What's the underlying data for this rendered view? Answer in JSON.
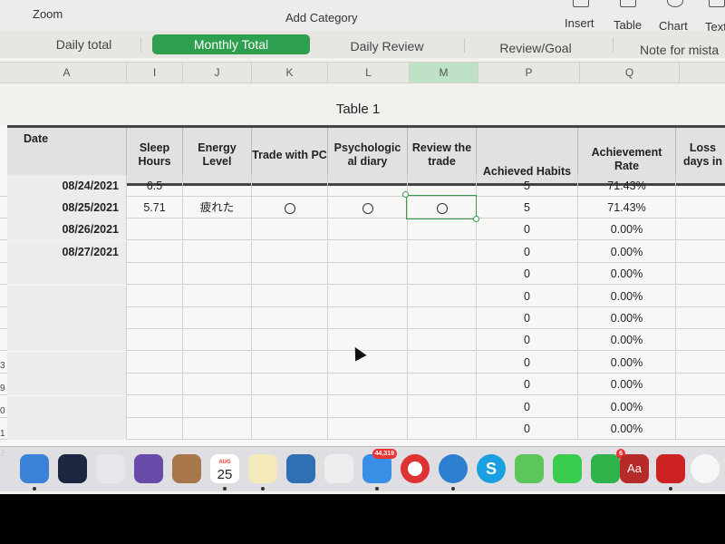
{
  "toolbar": {
    "zoom": "Zoom",
    "add_category": "Add Category",
    "insert": "Insert",
    "table": "Table",
    "chart": "Chart",
    "text": "Text"
  },
  "tabs": [
    {
      "label": "Daily total",
      "active": false
    },
    {
      "label": "Monthly Total",
      "active": true
    },
    {
      "label": "Daily Review",
      "active": false
    },
    {
      "label": "Review/Goal",
      "active": false
    },
    {
      "label": "Note for mista",
      "active": false
    }
  ],
  "columns": [
    "A",
    "I",
    "J",
    "K",
    "L",
    "M",
    "P",
    "Q"
  ],
  "selected_column": "M",
  "table_title": "Table 1",
  "headers": {
    "date": "Date",
    "sleep": "Sleep Hours",
    "energy": "Energy Level",
    "trade_pc": "Trade with PC",
    "psych": "Psychologic al diary",
    "review": "Review the trade",
    "habits": "Achieved Habits",
    "rate": "Achievement Rate",
    "loss": "Loss days in"
  },
  "partial_row": {
    "date": "08/24/2021",
    "sleep": "6.5",
    "energy": "",
    "habits": "5",
    "rate": "71.43%"
  },
  "rows": [
    {
      "date": "08/25/2021",
      "sleep": "5.71",
      "energy": "疲れた",
      "trade_pc": "○",
      "psych": "○",
      "review": "○",
      "habits": "5",
      "rate": "71.43%"
    },
    {
      "date": "08/26/2021",
      "sleep": "",
      "energy": "",
      "trade_pc": "",
      "psych": "",
      "review": "",
      "habits": "0",
      "rate": "0.00%"
    },
    {
      "date": "08/27/2021",
      "sleep": "",
      "energy": "",
      "trade_pc": "",
      "psych": "",
      "review": "",
      "habits": "0",
      "rate": "0.00%"
    },
    {
      "date": "",
      "sleep": "",
      "energy": "",
      "trade_pc": "",
      "psych": "",
      "review": "",
      "habits": "0",
      "rate": "0.00%"
    },
    {
      "date": "",
      "sleep": "",
      "energy": "",
      "trade_pc": "",
      "psych": "",
      "review": "",
      "habits": "0",
      "rate": "0.00%"
    },
    {
      "date": "",
      "sleep": "",
      "energy": "",
      "trade_pc": "",
      "psych": "",
      "review": "",
      "habits": "0",
      "rate": "0.00%"
    },
    {
      "date": "",
      "sleep": "",
      "energy": "",
      "trade_pc": "",
      "psych": "",
      "review": "",
      "habits": "0",
      "rate": "0.00%"
    },
    {
      "date": "",
      "sleep": "",
      "energy": "",
      "trade_pc": "",
      "psych": "",
      "review": "",
      "habits": "0",
      "rate": "0.00%"
    },
    {
      "date": "",
      "sleep": "",
      "energy": "",
      "trade_pc": "",
      "psych": "",
      "review": "",
      "habits": "0",
      "rate": "0.00%"
    },
    {
      "date": "",
      "sleep": "",
      "energy": "",
      "trade_pc": "",
      "psych": "",
      "review": "",
      "habits": "0",
      "rate": "0.00%"
    },
    {
      "date": "",
      "sleep": "",
      "energy": "",
      "trade_pc": "",
      "psych": "",
      "review": "",
      "habits": "0",
      "rate": "0.00%"
    }
  ],
  "row_numbers": [
    "3",
    "9",
    "0",
    "1",
    "2"
  ],
  "dock": {
    "calendar_month": "AUG",
    "calendar_day": "25",
    "mail_badge": "44,319",
    "facetime_badge": "6",
    "dictionary_label": "Aa",
    "skype_label": "S",
    "apps": [
      "finder-icon",
      "launchpad-icon",
      "apps-grid-icon",
      "omnifocus-icon",
      "contacts-icon",
      "calendar-icon",
      "notes-icon",
      "keynote-icon",
      "evernote-icon",
      "mail-icon",
      "chrome-icon",
      "safari-icon",
      "skype-icon",
      "messages-icon",
      "line-icon",
      "facetime-icon",
      "dictionary-icon",
      "photo-booth-icon",
      "photos-icon"
    ]
  },
  "colors": {
    "accent_green": "#2e9e4f",
    "selected_column": "#bfe1c5"
  }
}
